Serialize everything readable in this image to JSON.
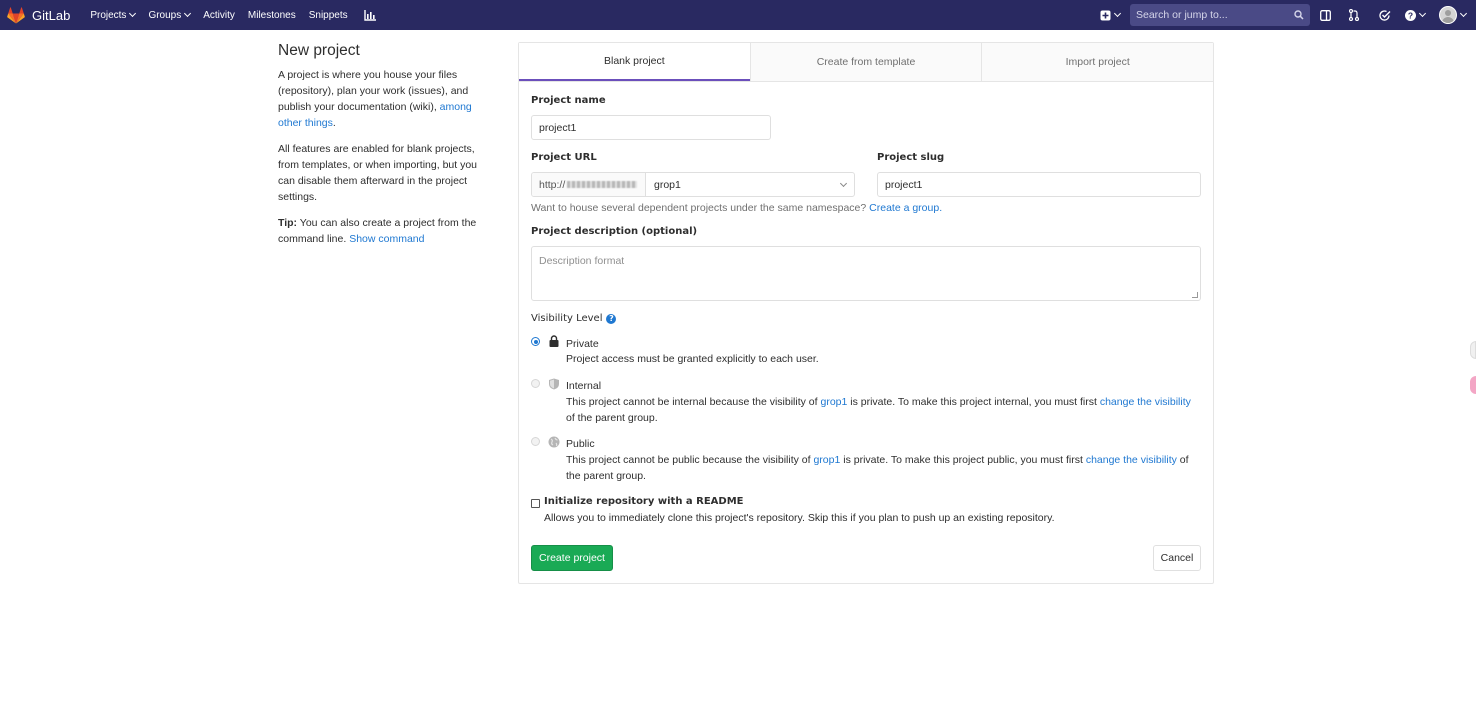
{
  "navbar": {
    "brand": "GitLab",
    "links": [
      {
        "label": "Projects",
        "dropdown": true
      },
      {
        "label": "Groups",
        "dropdown": true
      },
      {
        "label": "Activity",
        "dropdown": false
      },
      {
        "label": "Milestones",
        "dropdown": false
      },
      {
        "label": "Snippets",
        "dropdown": false
      }
    ],
    "search_placeholder": "Search or jump to...",
    "icons": [
      "chart-icon",
      "plus-square-icon",
      "search-icon",
      "sidebar-icon",
      "merge-request-icon",
      "todo-check-icon",
      "help-icon",
      "avatar"
    ],
    "background": "#292961"
  },
  "left": {
    "title": "New project",
    "para1_text": "A project is where you house your files (repository), plan your work (issues), and publish your documentation (wiki), ",
    "para1_link": "among other things",
    "para1_end": ".",
    "para2": "All features are enabled for blank projects, from templates, or when importing, but you can disable them afterward in the project settings.",
    "tip_label": "Tip:",
    "tip_text": " You can also create a project from the command line. ",
    "tip_link": "Show command"
  },
  "tabs": [
    {
      "label": "Blank project",
      "active": true
    },
    {
      "label": "Create from template",
      "active": false
    },
    {
      "label": "Import project",
      "active": false
    }
  ],
  "form": {
    "project_name_label": "Project name",
    "project_name_value": "project1",
    "project_url_label": "Project URL",
    "url_prefix": "http://",
    "namespace_value": "grop1",
    "project_slug_label": "Project slug",
    "project_slug_value": "project1",
    "namespace_help": "Want to house several dependent projects under the same namespace? ",
    "namespace_help_link": "Create a group.",
    "description_label": "Project description (optional)",
    "description_placeholder": "Description format",
    "visibility_label": "Visibility Level",
    "visibility": [
      {
        "name": "Private",
        "desc_parts": [
          "Project access must be granted explicitly to each user."
        ],
        "checked": true,
        "disabled": false,
        "icon": "lock-icon"
      },
      {
        "name": "Internal",
        "desc_a": "This project cannot be internal because the visibility of ",
        "group": "grop1",
        "desc_b": " is private. To make this project internal, you must first ",
        "link": "change the visibility",
        "desc_c": " of the parent group.",
        "checked": false,
        "disabled": true,
        "icon": "shield-icon"
      },
      {
        "name": "Public",
        "desc_a": "This project cannot be public because the visibility of ",
        "group": "grop1",
        "desc_b": " is private. To make this project public, you must first ",
        "link": "change the visibility",
        "desc_c": " of the parent group.",
        "checked": false,
        "disabled": true,
        "icon": "globe-icon"
      }
    ],
    "readme_label": "Initialize repository with a README",
    "readme_help": "Allows you to immediately clone this project's repository. Skip this if you plan to push up an existing repository.",
    "create_button": "Create project",
    "cancel_button": "Cancel"
  },
  "colors": {
    "link": "#1f78d1",
    "primary_button": "#1aaa55",
    "active_tab_border": "#6b4fbb"
  }
}
